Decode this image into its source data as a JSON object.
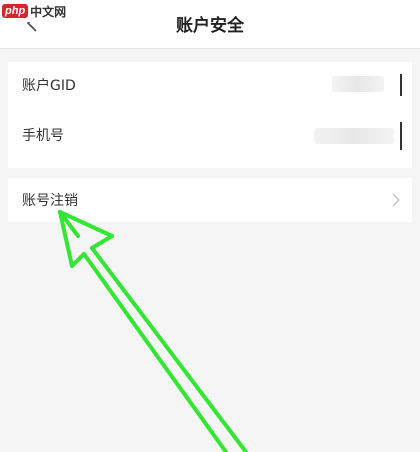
{
  "watermark": {
    "logo": "php",
    "text": "中文网"
  },
  "header": {
    "back_icon": "chevron-left-icon",
    "title": "账户安全"
  },
  "rows": [
    {
      "label": "账户GID"
    },
    {
      "label": "手机号"
    },
    {
      "label": "账号注销",
      "icon": "chevron-right-icon"
    }
  ],
  "colors": {
    "annotation_arrow": "#33e633",
    "background": "#f5f5f5"
  }
}
